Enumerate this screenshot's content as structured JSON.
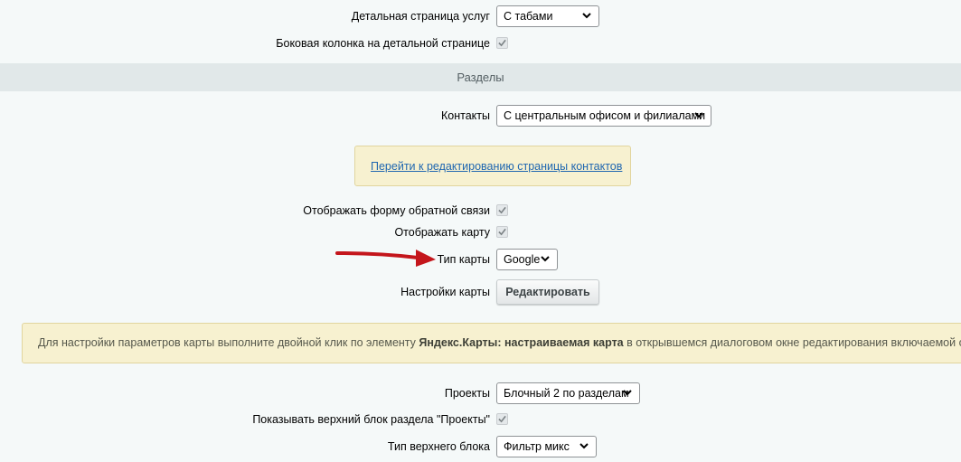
{
  "detail_page": {
    "label": "Детальная страница услуг",
    "value": "С табами"
  },
  "sidebar_column": {
    "label": "Боковая колонка на детальной странице",
    "checked": true
  },
  "section_title": "Разделы",
  "contacts": {
    "label": "Контакты",
    "value": "С центральным офисом и филиалами"
  },
  "edit_contacts_link": "Перейти к редактированию страницы контактов",
  "feedback_form": {
    "label": "Отображать форму обратной связи",
    "checked": true
  },
  "show_map": {
    "label": "Отображать карту",
    "checked": true
  },
  "map_type": {
    "label": "Тип карты",
    "value": "Google"
  },
  "map_settings": {
    "label": "Настройки карты",
    "button": "Редактировать"
  },
  "map_hint": {
    "before": "Для настройки параметров карты выполните двойной клик по элементу ",
    "bold": "Яндекс.Карты: настраиваемая карта",
    "after": " в открывшемся диалоговом окне редактирования включаемой области"
  },
  "projects": {
    "label": "Проекты",
    "value": "Блочный 2 по разделам"
  },
  "projects_top_block": {
    "label": "Показывать верхний блок раздела \"Проекты\"",
    "checked": true
  },
  "top_block_type": {
    "label": "Тип верхнего блока",
    "value": "Фильтр микс"
  },
  "colors": {
    "arrow": "#c4161c",
    "note_bg": "#f7f1d0",
    "link": "#2067b0"
  }
}
